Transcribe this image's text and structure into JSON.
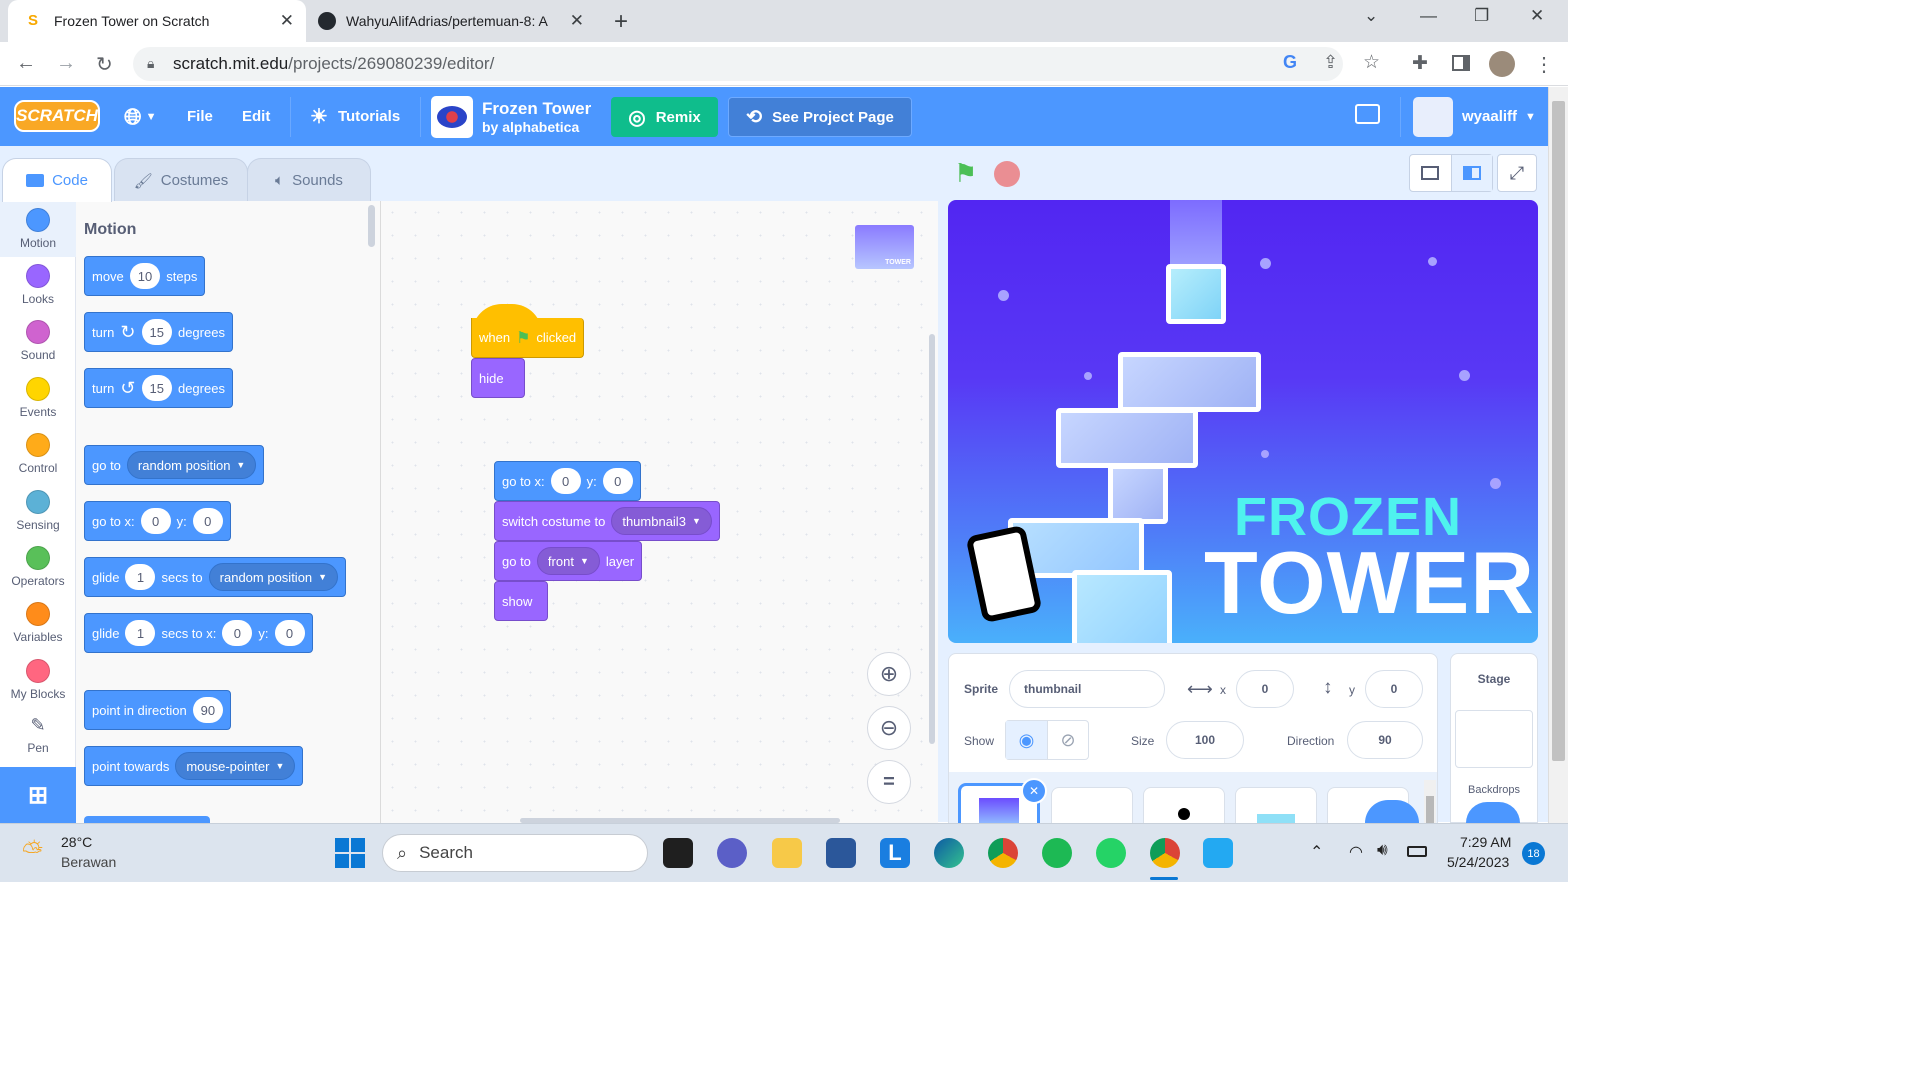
{
  "browser": {
    "tabs": [
      {
        "title": "Frozen Tower on Scratch",
        "active": true
      },
      {
        "title": "WahyuAlifAdrias/pertemuan-8: A",
        "active": false
      }
    ],
    "url_domain": "scratch.mit.edu",
    "url_path": "/projects/269080239/editor/"
  },
  "menubar": {
    "logo": "SCRATCH",
    "file": "File",
    "edit": "Edit",
    "tutorials": "Tutorials",
    "project_title": "Frozen Tower",
    "project_author": "by alphabetica",
    "remix": "Remix",
    "see_project": "See Project Page",
    "username": "wyaaliff"
  },
  "editor_tabs": [
    "Code",
    "Costumes",
    "Sounds"
  ],
  "categories": [
    {
      "label": "Motion",
      "color": "#4c97ff"
    },
    {
      "label": "Looks",
      "color": "#9966ff"
    },
    {
      "label": "Sound",
      "color": "#cf63cf"
    },
    {
      "label": "Events",
      "color": "#ffd500"
    },
    {
      "label": "Control",
      "color": "#ffab19"
    },
    {
      "label": "Sensing",
      "color": "#5cb1d6"
    },
    {
      "label": "Operators",
      "color": "#59c059"
    },
    {
      "label": "Variables",
      "color": "#ff8c1a"
    },
    {
      "label": "My Blocks",
      "color": "#ff6680"
    },
    {
      "label": "Pen",
      "color": "#0fbd8c"
    }
  ],
  "palette": {
    "heading": "Motion",
    "move": {
      "a": "move",
      "n": "10",
      "b": "steps"
    },
    "turn_right": {
      "a": "turn",
      "n": "15",
      "b": "degrees"
    },
    "turn_left": {
      "a": "turn",
      "n": "15",
      "b": "degrees"
    },
    "goto": {
      "a": "go to",
      "d": "random position"
    },
    "gotoxy": {
      "a": "go to x:",
      "x": "0",
      "b": "y:",
      "y": "0"
    },
    "glide": {
      "a": "glide",
      "n": "1",
      "b": "secs to",
      "d": "random position"
    },
    "glidexy": {
      "a": "glide",
      "n": "1",
      "b": "secs to x:",
      "x": "0",
      "c": "y:",
      "y": "0"
    },
    "point": {
      "a": "point in direction",
      "n": "90"
    },
    "towards": {
      "a": "point towards",
      "d": "mouse-pointer"
    }
  },
  "script": {
    "hat": {
      "a": "when",
      "b": "clicked"
    },
    "hide": "hide",
    "gotoxy": {
      "a": "go to x:",
      "x": "0",
      "b": "y:",
      "y": "0"
    },
    "costume": {
      "a": "switch costume to",
      "d": "thumbnail3"
    },
    "layer": {
      "a": "go to",
      "d": "front",
      "b": "layer"
    },
    "show": "show",
    "zoom_reset": "="
  },
  "stage": {
    "line1": "FROZEN",
    "line2": "TOWER",
    "thumb": "TOWER"
  },
  "sprite_info": {
    "sprite_label": "Sprite",
    "sprite_name": "thumbnail",
    "x_label": "x",
    "x": "0",
    "y_label": "y",
    "y": "0",
    "show_label": "Show",
    "size_label": "Size",
    "size": "100",
    "direction_label": "Direction",
    "direction": "90"
  },
  "stage_pane": {
    "title": "Stage",
    "backdrops": "Backdrops"
  },
  "taskbar": {
    "temp": "28°C",
    "weather": "Berawan",
    "search": "Search",
    "time": "7:29 AM",
    "date": "5/24/2023",
    "badge": "18"
  }
}
